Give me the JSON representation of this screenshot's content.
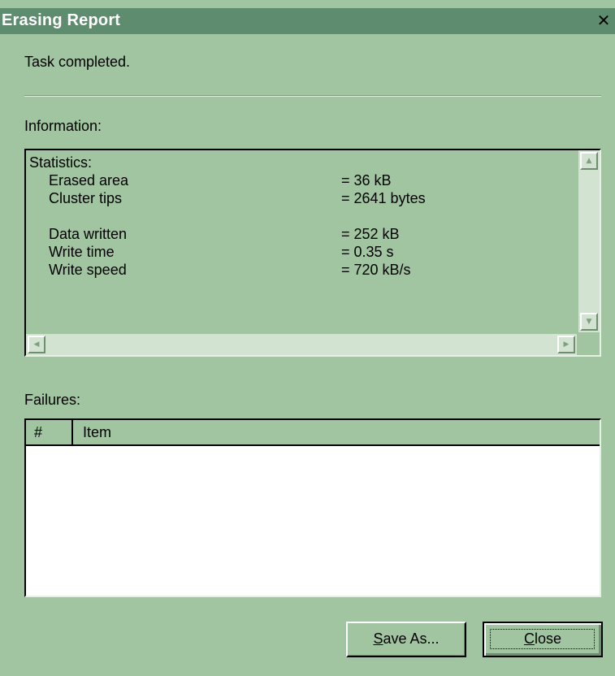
{
  "window": {
    "title": "Erasing Report",
    "close_glyph": "✕",
    "close_icon": "close-icon"
  },
  "status": {
    "text": "Task completed."
  },
  "information": {
    "label": "Information:",
    "heading": "Statistics:",
    "stats": [
      {
        "name": "Erased area",
        "value": "= 36 kB"
      },
      {
        "name": "Cluster tips",
        "value": "= 2641 bytes"
      },
      {
        "name": "Data written",
        "value": "= 252 kB"
      },
      {
        "name": "Write time",
        "value": "= 0.35 s"
      },
      {
        "name": "Write speed",
        "value": "= 720 kB/s"
      }
    ],
    "scroll_icons": {
      "up": "▲",
      "down": "▼",
      "left": "◀",
      "right": "▶"
    }
  },
  "failures": {
    "label": "Failures:",
    "columns": [
      "#",
      "Item"
    ],
    "rows": []
  },
  "buttons": {
    "save_as_accel": "S",
    "save_as_rest": "ave As...",
    "close_accel": "C",
    "close_rest": "lose"
  },
  "colors": {
    "window_bg": "#a1c4a1",
    "titlebar_bg": "#5e8c6e",
    "list_bg": "#ffffff"
  }
}
